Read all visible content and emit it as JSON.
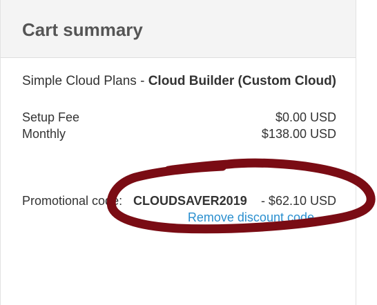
{
  "cart": {
    "title": "Cart summary",
    "product": {
      "group": "Simple Cloud Plans",
      "separator": " - ",
      "name": "Cloud Builder (Custom Cloud)"
    },
    "fees": [
      {
        "label": "Setup Fee",
        "value": "$0.00 USD"
      },
      {
        "label": "Monthly",
        "value": "$138.00 USD"
      }
    ],
    "promo": {
      "label": "Promotional code:",
      "code": "CLOUDSAVER2019",
      "amount": "- $62.10 USD",
      "remove_label": "Remove discount code"
    }
  },
  "annotation": {
    "color": "#7a0c14"
  }
}
